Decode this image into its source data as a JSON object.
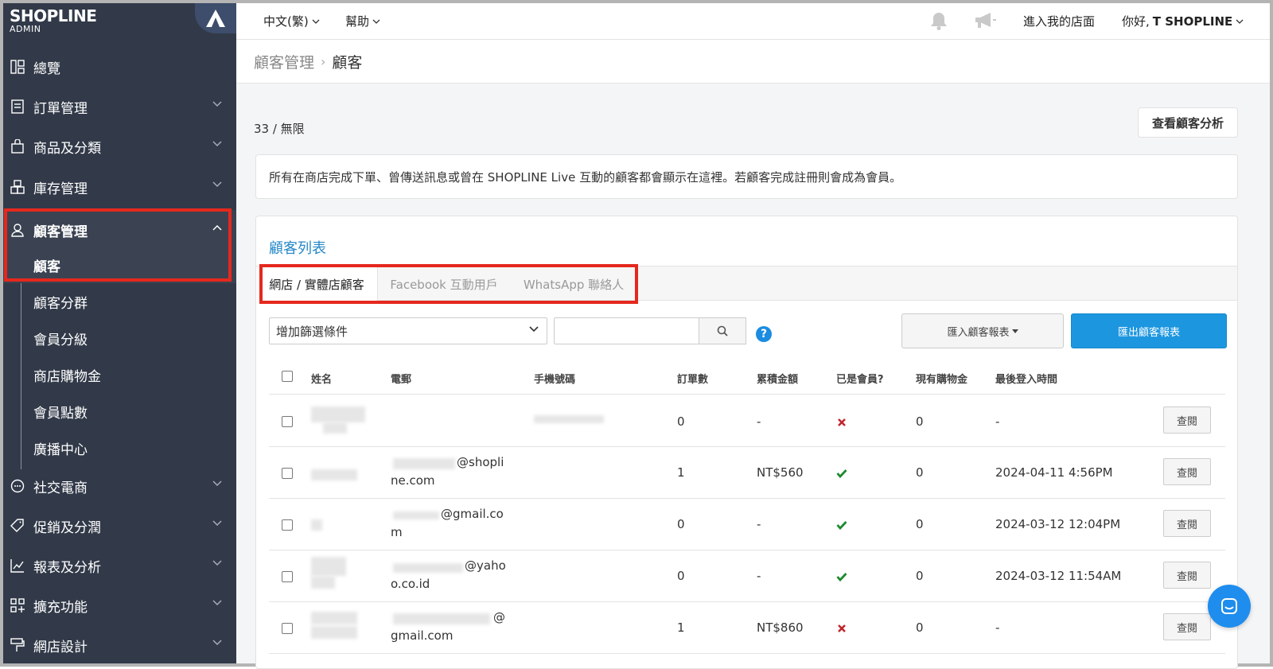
{
  "colors": {
    "sidebar_bg": "#323a49",
    "accent": "#2588c8",
    "export_btn": "#1d96e0",
    "highlight": "#e5281d",
    "check": "#1e8a2e",
    "cross": "#c0262d"
  },
  "brand": {
    "name": "SHOPLINE",
    "sub": "ADMIN"
  },
  "sidebar": {
    "items": [
      {
        "label": "總覽",
        "icon": "dashboard-icon"
      },
      {
        "label": "訂單管理",
        "icon": "order-icon"
      },
      {
        "label": "商品及分類",
        "icon": "bag-icon"
      },
      {
        "label": "庫存管理",
        "icon": "inventory-icon"
      },
      {
        "label": "顧客管理",
        "icon": "user-icon"
      },
      {
        "label": "社交電商",
        "icon": "chat-icon"
      },
      {
        "label": "促銷及分潤",
        "icon": "tag-icon"
      },
      {
        "label": "報表及分析",
        "icon": "chart-icon"
      },
      {
        "label": "擴充功能",
        "icon": "apps-icon"
      },
      {
        "label": "網店設計",
        "icon": "brush-icon"
      }
    ],
    "sub_items": [
      "顧客",
      "顧客分群",
      "會員分級",
      "商店購物金",
      "會員點數",
      "廣播中心"
    ]
  },
  "topbar": {
    "language": "中文(繁)",
    "help": "幫助",
    "store_link": "進入我的店面",
    "greeting": "你好, ",
    "user": "T SHOPLINE"
  },
  "breadcrumb": {
    "parent": "顧客管理",
    "current": "顧客"
  },
  "count": "33 / 無限",
  "analytics_button": "查看顧客分析",
  "notice": "所有在商店完成下單、曾傳送訊息或曾在 SHOPLINE Live 互動的顧客都會顯示在這裡。若顧客完成註冊則會成為會員。",
  "card_title": "顧客列表",
  "tabs": [
    "網店 / 實體店顧客",
    "Facebook 互動用戶",
    "WhatsApp 聯絡人"
  ],
  "filter": {
    "placeholder": "增加篩選條件"
  },
  "import_button": "匯入顧客報表",
  "export_button": "匯出顧客報表",
  "columns": [
    "姓名",
    "電郵",
    "手機號碼",
    "訂單數",
    "累積金額",
    "已是會員?",
    "現有購物金",
    "最後登入時間"
  ],
  "rows": [
    {
      "email1": "",
      "email2": "",
      "orders": "0",
      "amount": "-",
      "member": "no",
      "credit": "0",
      "last_login": "-"
    },
    {
      "email1": "@shopli",
      "email2": "ne.com",
      "orders": "1",
      "amount": "NT$560",
      "member": "yes",
      "credit": "0",
      "last_login": "2024-04-11 4:56PM"
    },
    {
      "email1": "@gmail.co",
      "email2": "m",
      "orders": "0",
      "amount": "-",
      "member": "yes",
      "credit": "0",
      "last_login": "2024-03-12 12:04PM"
    },
    {
      "email1": "@yaho",
      "email2": "o.co.id",
      "orders": "0",
      "amount": "-",
      "member": "yes",
      "credit": "0",
      "last_login": "2024-03-12 11:54AM"
    },
    {
      "email1": "@",
      "email2": "gmail.com",
      "orders": "1",
      "amount": "NT$860",
      "member": "no",
      "credit": "0",
      "last_login": "-"
    }
  ],
  "view_label": "查閱"
}
